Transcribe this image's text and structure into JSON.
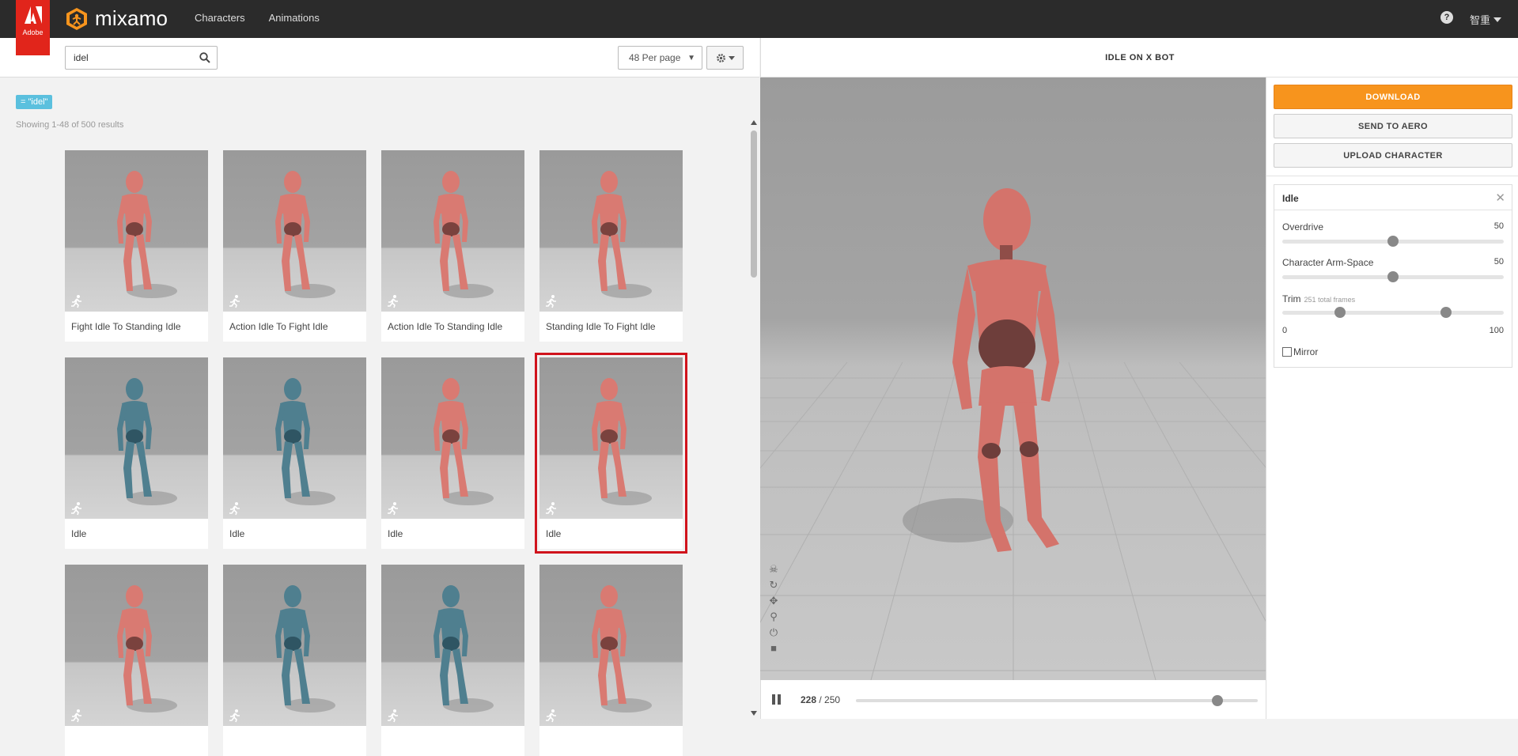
{
  "topbar": {
    "adobe_label": "Adobe",
    "logo_text": "mixamo",
    "nav": [
      "Characters",
      "Animations"
    ],
    "help": "?",
    "user": "智重"
  },
  "search": {
    "value": "idel",
    "per_page": "48 Per page"
  },
  "filter_tag": "= \"idel\"",
  "results": "Showing 1-48 of 500 results",
  "cards": [
    {
      "label": "Fight Idle To Standing Idle",
      "color": "#d97a72"
    },
    {
      "label": "Action Idle To Fight Idle",
      "color": "#d97a72"
    },
    {
      "label": "Action Idle To Standing Idle",
      "color": "#d97a72"
    },
    {
      "label": "Standing Idle To Fight Idle",
      "color": "#d97a72"
    },
    {
      "label": "Idle",
      "color": "#4f7f8f"
    },
    {
      "label": "Idle",
      "color": "#4f7f8f"
    },
    {
      "label": "Idle",
      "color": "#d97a72"
    },
    {
      "label": "Idle",
      "color": "#d97a72",
      "selected": true
    },
    {
      "label": "",
      "color": "#d97a72"
    },
    {
      "label": "",
      "color": "#4f7f8f"
    },
    {
      "label": "",
      "color": "#4f7f8f"
    },
    {
      "label": "",
      "color": "#d97a72"
    }
  ],
  "viewer": {
    "title": "IDLE ON X BOT",
    "frame_current": "228",
    "frame_total": "/ 250",
    "progress": 0.9
  },
  "side": {
    "download": "DOWNLOAD",
    "send_aero": "SEND TO AERO",
    "upload": "UPLOAD CHARACTER",
    "settings_title": "Idle",
    "overdrive_label": "Overdrive",
    "overdrive_value": "50",
    "overdrive_fraction": 0.5,
    "armspace_label": "Character Arm-Space",
    "armspace_value": "50",
    "armspace_fraction": 0.5,
    "trim_label": "Trim",
    "trim_hint": "251 total frames",
    "trim_start_fraction": 0.26,
    "trim_end_fraction": 0.74,
    "trim_min": "0",
    "trim_max": "100",
    "mirror_label": "Mirror"
  },
  "colors": {
    "accent": "#f7941d",
    "selection": "#d0131c",
    "tag": "#5bc0de"
  }
}
